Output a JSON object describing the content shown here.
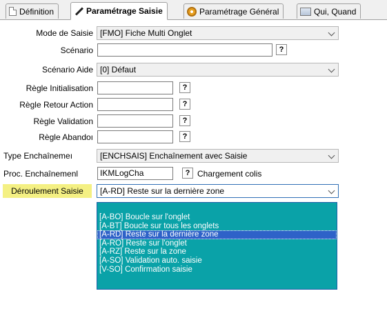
{
  "tabs": [
    {
      "label": "Définition",
      "icon": "document-icon"
    },
    {
      "label": "Paramétrage Saisie",
      "icon": "pencil-icon",
      "active": true
    },
    {
      "label": "Paramétrage Général",
      "icon": "gear-icon"
    },
    {
      "label": "Qui, Quand",
      "icon": "people-icon"
    }
  ],
  "form": {
    "mode_saisie": {
      "label": "Mode de Saisie",
      "value": "[FMO] Fiche Multi Onglet"
    },
    "scenario": {
      "label": "Scénario",
      "value": "",
      "help": "?"
    },
    "scenario_aide": {
      "label": "Scénario Aide",
      "value": "[0] Défaut"
    },
    "regle_init": {
      "label": "Règle Initialisation",
      "value": "",
      "help": "?"
    },
    "regle_retour": {
      "label": "Règle Retour Action",
      "value": "",
      "help": "?"
    },
    "regle_validation": {
      "label": "Règle Validation",
      "value": "",
      "help": "?"
    },
    "regle_abandon": {
      "label": "Règle Abandoı",
      "value": "",
      "help": "?"
    },
    "type_enchainement": {
      "label": "Type Enchaînemeı",
      "value": "[ENCHSAIS] Enchaînement avec Saisie"
    },
    "proc_enchainement": {
      "label": "Proc. Enchaînemenl",
      "value": "IKMLogCha",
      "help": "?",
      "extra": "Chargement colis"
    },
    "deroulement_saisie": {
      "label": "Déroulement Saisie",
      "value": "[A-RD] Reste sur la dernière zone"
    }
  },
  "dropdown": {
    "options": [
      "[A-BO] Boucle sur l'onglet",
      "[A-BT] Boucle sur tous les onglets",
      "[A-RD] Reste sur la dernière zone",
      "[A-RO] Reste sur l'onglet",
      "[A-RZ] Reste sur la zone",
      "[A-SO] Validation auto. saisie",
      "[V-SO] Confirmation saisie"
    ],
    "selected_index": 2
  },
  "colors": {
    "highlight_label": "#f4f083",
    "list_bg": "#0aa2a8",
    "list_selected": "#2e62c8"
  }
}
